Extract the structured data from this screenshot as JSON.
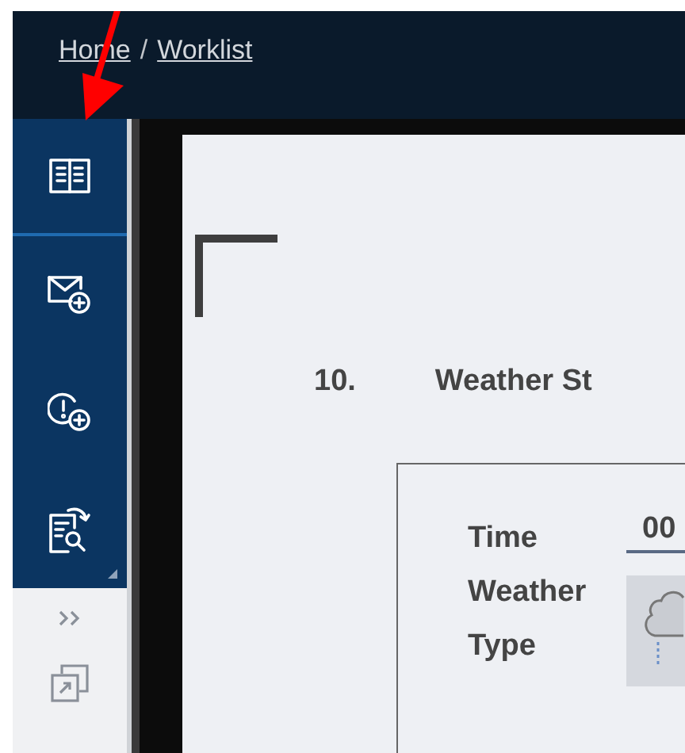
{
  "breadcrumb": {
    "links": [
      {
        "label": "Home"
      },
      {
        "label": "Worklist"
      }
    ],
    "separator": "/"
  },
  "sidebar": {
    "items": [
      {
        "kind": "book"
      },
      {
        "kind": "mail-add"
      },
      {
        "kind": "alert-add"
      },
      {
        "kind": "doc-search"
      }
    ],
    "footer": [
      {
        "kind": "expand"
      },
      {
        "kind": "popout"
      }
    ]
  },
  "document": {
    "number": "10.",
    "heading": "Weather St",
    "fields": [
      {
        "kind": "text",
        "label": "Time",
        "value": "00"
      },
      {
        "kind": "icon",
        "label": "Weather Type"
      }
    ]
  },
  "annotations": [
    {
      "kind": "arrow"
    }
  ]
}
